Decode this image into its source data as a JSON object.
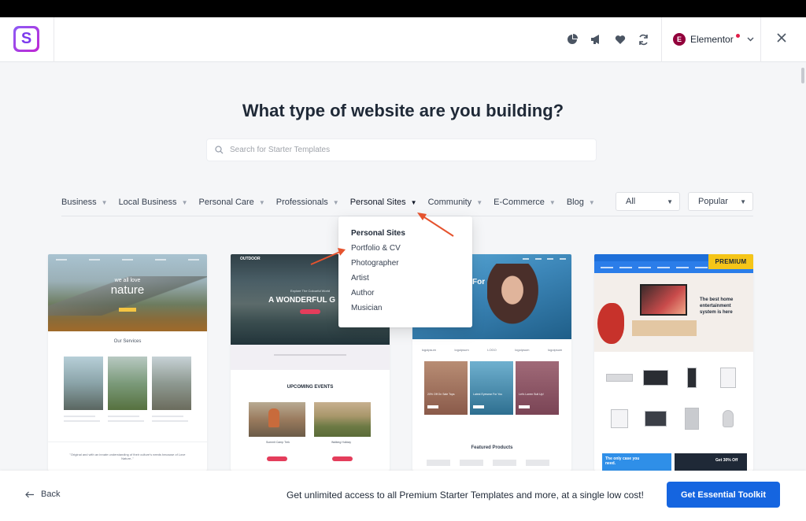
{
  "header": {
    "logo_letter": "S",
    "icons": [
      "pie-chart-icon",
      "megaphone-icon",
      "heart-icon",
      "sync-icon"
    ],
    "builder": {
      "badge": "E",
      "label": "Elementor"
    },
    "close_symbol": "✕"
  },
  "page": {
    "title": "What type of website are you building?"
  },
  "search": {
    "placeholder": "Search for Starter Templates"
  },
  "categories": [
    {
      "label": "Business",
      "active": false
    },
    {
      "label": "Local Business",
      "active": false
    },
    {
      "label": "Personal Care",
      "active": false
    },
    {
      "label": "Professionals",
      "active": false
    },
    {
      "label": "Personal Sites",
      "active": true
    },
    {
      "label": "Community",
      "active": false
    },
    {
      "label": "E-Commerce",
      "active": false
    },
    {
      "label": "Blog",
      "active": false
    }
  ],
  "filters": {
    "type": "All",
    "sort": "Popular"
  },
  "dropdown": {
    "heading": "Personal Sites",
    "items": [
      "Portfolio & CV",
      "Photographer",
      "Artist",
      "Author",
      "Musician"
    ]
  },
  "cards": {
    "card1": {
      "hero_small": "we all love",
      "hero_big": "nature",
      "section": "Our Services",
      "quote": "\"Original and with an innate understanding of their culture's needs because of Love Nature..\""
    },
    "card2": {
      "logo": "OUTDOOR",
      "kicker": "Explore The Colourful World",
      "headline": "A WONDERFUL G",
      "section": "UPCOMING EVENTS",
      "caption1": "Summit Camp Trek",
      "caption2": "Walking Holiday"
    },
    "card3": {
      "hero_text": "For",
      "logos": [
        "logoipsum",
        "logoipsum",
        "LOGO",
        "logoipsum",
        "logoipsum"
      ],
      "tile1": "20% Off On Sale Tops",
      "tile2": "Latest Eyewear For You",
      "tile3": "Let's Lorem Suit Up!",
      "section": "Featured Products"
    },
    "card4": {
      "badge": "PREMIUM",
      "hero_text": "The best home entertainment system is here",
      "banner1": "The only case you need.",
      "banner2": "Get 30% Off"
    }
  },
  "footer": {
    "back_label": "Back",
    "promo": "Get unlimited access to all Premium Starter Templates and more, at a single low cost!",
    "cta": "Get Essential Toolkit"
  },
  "colors": {
    "accent": "#1565e0",
    "premium": "#f5c518",
    "arrow": "#e5532e"
  }
}
